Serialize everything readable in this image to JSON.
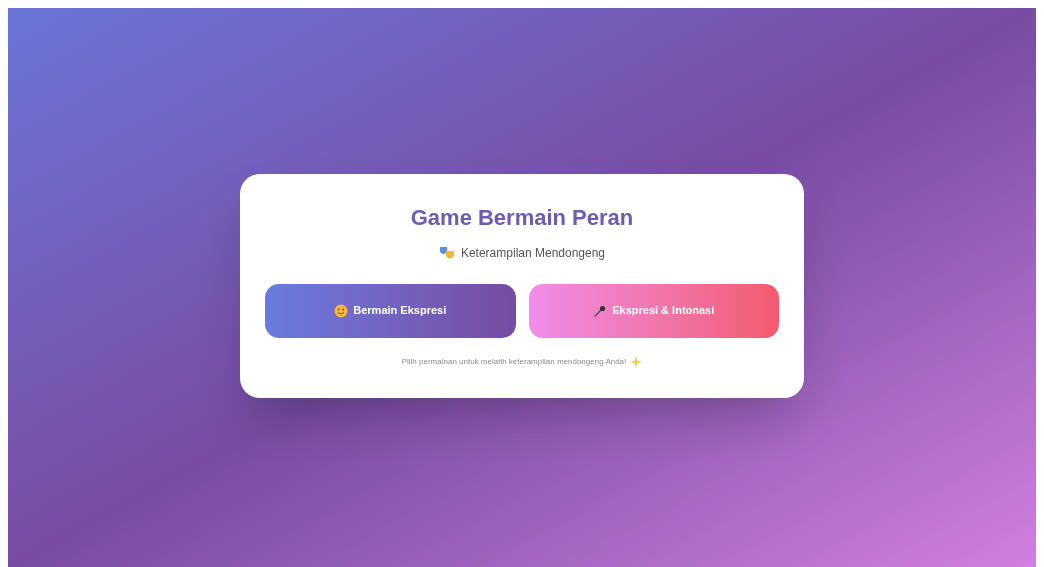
{
  "card": {
    "title": "Game Bermain Peran",
    "subtitle": "Keterampilan Mendongeng",
    "buttons": [
      {
        "label": "Bermain Ekspresi",
        "kind": "expression"
      },
      {
        "label": "Ekspresi & Intonasi",
        "kind": "intonation"
      }
    ],
    "footer": "Pilih permainan untuk melatih keterampilan mendongeng Anda!"
  }
}
